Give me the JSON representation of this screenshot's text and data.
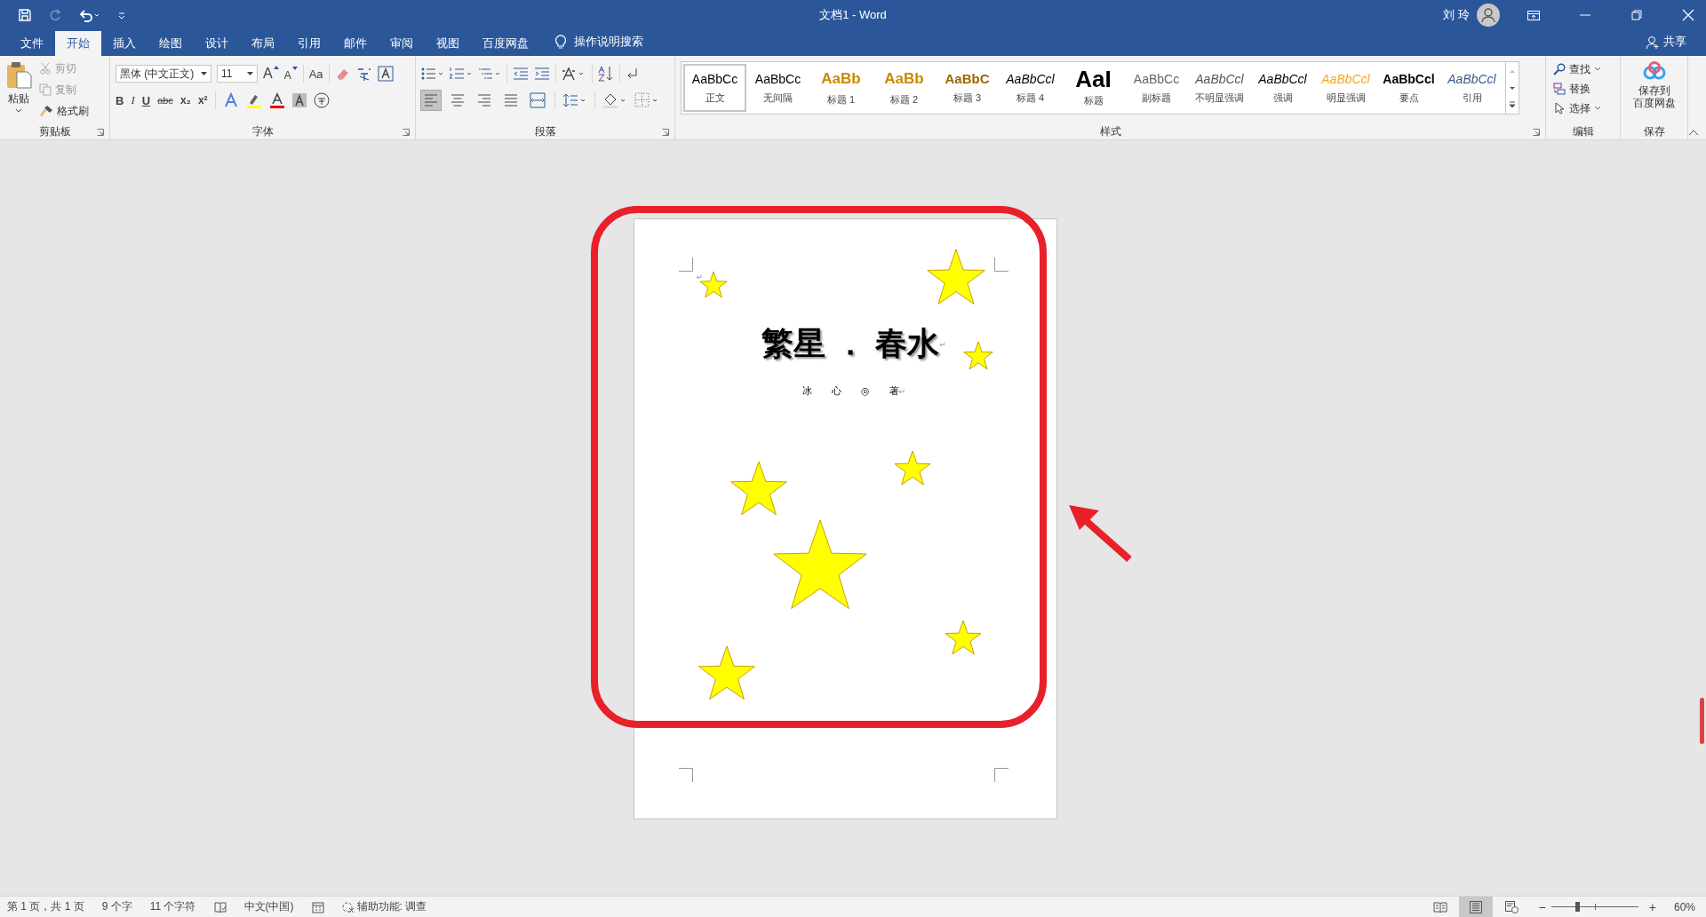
{
  "window": {
    "title": "文档1  -  Word",
    "user": "刘 玲"
  },
  "tabs": [
    {
      "label": "文件",
      "selected": false
    },
    {
      "label": "开始",
      "selected": true
    },
    {
      "label": "插入",
      "selected": false
    },
    {
      "label": "绘图",
      "selected": false
    },
    {
      "label": "设计",
      "selected": false
    },
    {
      "label": "布局",
      "selected": false
    },
    {
      "label": "引用",
      "selected": false
    },
    {
      "label": "邮件",
      "selected": false
    },
    {
      "label": "审阅",
      "selected": false
    },
    {
      "label": "视图",
      "selected": false
    },
    {
      "label": "百度网盘",
      "selected": false
    }
  ],
  "tell_me": "操作说明搜索",
  "share": "共享",
  "ribbon": {
    "clipboard": {
      "paste": "粘贴",
      "cut": "剪切",
      "copy": "复制",
      "format_painter": "格式刷",
      "label": "剪贴板"
    },
    "font": {
      "name": "黑体 (中文正文)",
      "size": "11",
      "grow": "A",
      "shrink": "A",
      "case": "Aa",
      "bold": "B",
      "italic": "I",
      "underline": "U",
      "strike": "abc",
      "subscript": "x₂",
      "superscript": "x²",
      "label": "字体"
    },
    "paragraph": {
      "alignment": [
        {
          "kind": "left",
          "selected": true
        },
        {
          "kind": "center",
          "selected": false
        },
        {
          "kind": "right",
          "selected": false
        },
        {
          "kind": "justify",
          "selected": false
        },
        {
          "kind": "distributed",
          "selected": false
        }
      ],
      "label": "段落"
    },
    "styles": {
      "items": [
        {
          "preview": "AaBbCc",
          "name": "正文",
          "kind": "normal",
          "selected": true
        },
        {
          "preview": "AaBbCc",
          "name": "无间隔",
          "kind": "normal",
          "selected": false
        },
        {
          "preview": "AaBb",
          "name": "标题 1",
          "kind": "heading1",
          "selected": false
        },
        {
          "preview": "AaBb",
          "name": "标题 2",
          "kind": "heading2",
          "selected": false
        },
        {
          "preview": "AaBbC",
          "name": "标题 3",
          "kind": "heading3",
          "selected": false
        },
        {
          "preview": "AaBbCcl",
          "name": "标题 4",
          "kind": "heading4",
          "selected": false
        },
        {
          "preview": "AaI",
          "name": "标题",
          "kind": "title",
          "selected": false
        },
        {
          "preview": "AaBbCc",
          "name": "副标题",
          "kind": "subtitle",
          "selected": false
        },
        {
          "preview": "AaBbCcl",
          "name": "不明显强调",
          "kind": "subtle",
          "selected": false
        },
        {
          "preview": "AaBbCcl",
          "name": "强调",
          "kind": "emphasis",
          "selected": false
        },
        {
          "preview": "AaBbCcl",
          "name": "明显强调",
          "kind": "intense",
          "selected": false
        },
        {
          "preview": "AaBbCcl",
          "name": "要点",
          "kind": "strong",
          "selected": false
        },
        {
          "preview": "AaBbCcl",
          "name": "引用",
          "kind": "quote",
          "selected": false
        }
      ],
      "label": "样式"
    },
    "editing": {
      "find": "查找",
      "replace": "替换",
      "select": "选择",
      "label": "编辑"
    },
    "save": {
      "button_line1": "保存到",
      "button_line2": "百度网盘",
      "label": "保存"
    }
  },
  "document": {
    "first_mark": "↵",
    "title": "繁星 ． 春水",
    "title_mark": "↵",
    "author": "冰　　心　　◎　　著",
    "author_mark": "↵"
  },
  "status_bar": {
    "page": "第 1 页，共 1 页",
    "words": "9 个字",
    "chars": "11 个字符",
    "language": "中文(中国)",
    "accessibility": "辅助功能: 调查",
    "views": [
      {
        "kind": "read",
        "selected": false
      },
      {
        "kind": "print",
        "selected": true
      },
      {
        "kind": "web",
        "selected": false
      }
    ],
    "zoom_out": "−",
    "zoom_in": "+",
    "zoom": {
      "level": 0.3
    },
    "zoom_percent": "60%"
  }
}
